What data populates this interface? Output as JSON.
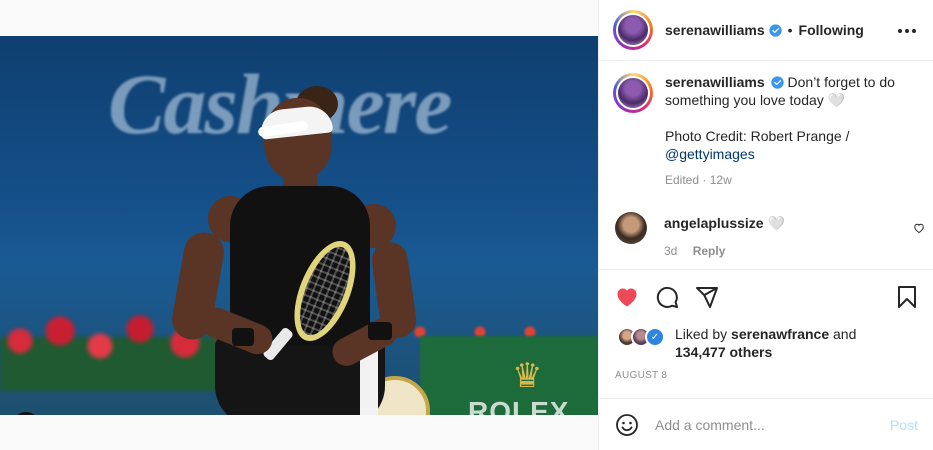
{
  "post": {
    "username": "serenawilliams",
    "follow_separator": "•",
    "follow_status": "Following",
    "caption": {
      "username": "serenawilliams",
      "text": "Don’t forget to do something you love today 🤍",
      "credit_prefix": "Photo Credit: Robert Prange /",
      "credit_handle": "@gettyimages",
      "edited": "Edited",
      "edited_sep": "·",
      "age": "12w"
    },
    "comments": [
      {
        "username": "angelaplussize",
        "text": "🤍",
        "age": "3d",
        "reply_label": "Reply"
      }
    ],
    "likes": {
      "prefix": "Liked by",
      "liker": "serenawfrance",
      "conj": "and",
      "others": "134,477 others"
    },
    "date": "AUGUST 8",
    "add_comment_placeholder": "Add a comment...",
    "post_label": "Post"
  },
  "image_text": {
    "banner": "Cashmere",
    "sponsor": "ROLEX"
  },
  "colors": {
    "like_red": "#ed4956",
    "verified_blue": "#3897f0",
    "post_disabled": "#b2dffc",
    "link": "#00376b",
    "meta_gray": "#8e8e8e"
  },
  "icons": [
    "user-tag-icon",
    "verified-icon",
    "more-options-icon",
    "heart-icon",
    "comment-icon",
    "share-icon",
    "bookmark-icon",
    "emoji-icon"
  ]
}
